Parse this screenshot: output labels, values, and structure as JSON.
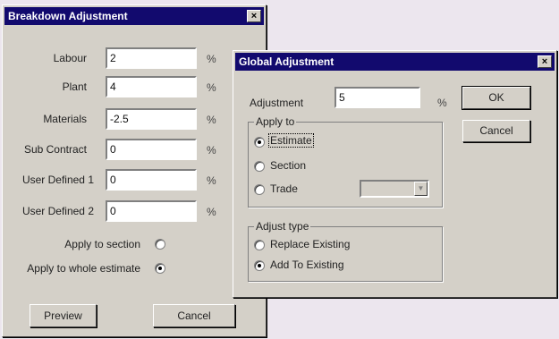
{
  "breakdown": {
    "title": "Breakdown Adjustment",
    "close_glyph": "×",
    "rows": [
      {
        "label": "Labour",
        "value": "2",
        "unit": "%"
      },
      {
        "label": "Plant",
        "value": "4",
        "unit": "%"
      },
      {
        "label": "Materials",
        "value": "-2.5",
        "unit": "%"
      },
      {
        "label": "Sub Contract",
        "value": "0",
        "unit": "%"
      },
      {
        "label": "User Defined 1",
        "value": "0",
        "unit": "%"
      },
      {
        "label": "User Defined 2",
        "value": "0",
        "unit": "%"
      }
    ],
    "apply_section_label": "Apply to section",
    "apply_whole_label": "Apply to whole estimate",
    "apply_selected": "whole",
    "preview_label": "Preview",
    "cancel_label": "Cancel"
  },
  "global": {
    "title": "Global Adjustment",
    "close_glyph": "×",
    "adjustment_label": "Adjustment",
    "adjustment_value": "5",
    "adjustment_unit": "%",
    "ok_label": "OK",
    "cancel_label": "Cancel",
    "apply_to": {
      "title": "Apply to",
      "options": [
        "Estimate",
        "Section",
        "Trade"
      ],
      "selected": "Estimate"
    },
    "trade_value": "",
    "adjust_type": {
      "title": "Adjust type",
      "options": [
        "Replace Existing",
        "Add To Existing"
      ],
      "selected": "Add To Existing"
    }
  }
}
